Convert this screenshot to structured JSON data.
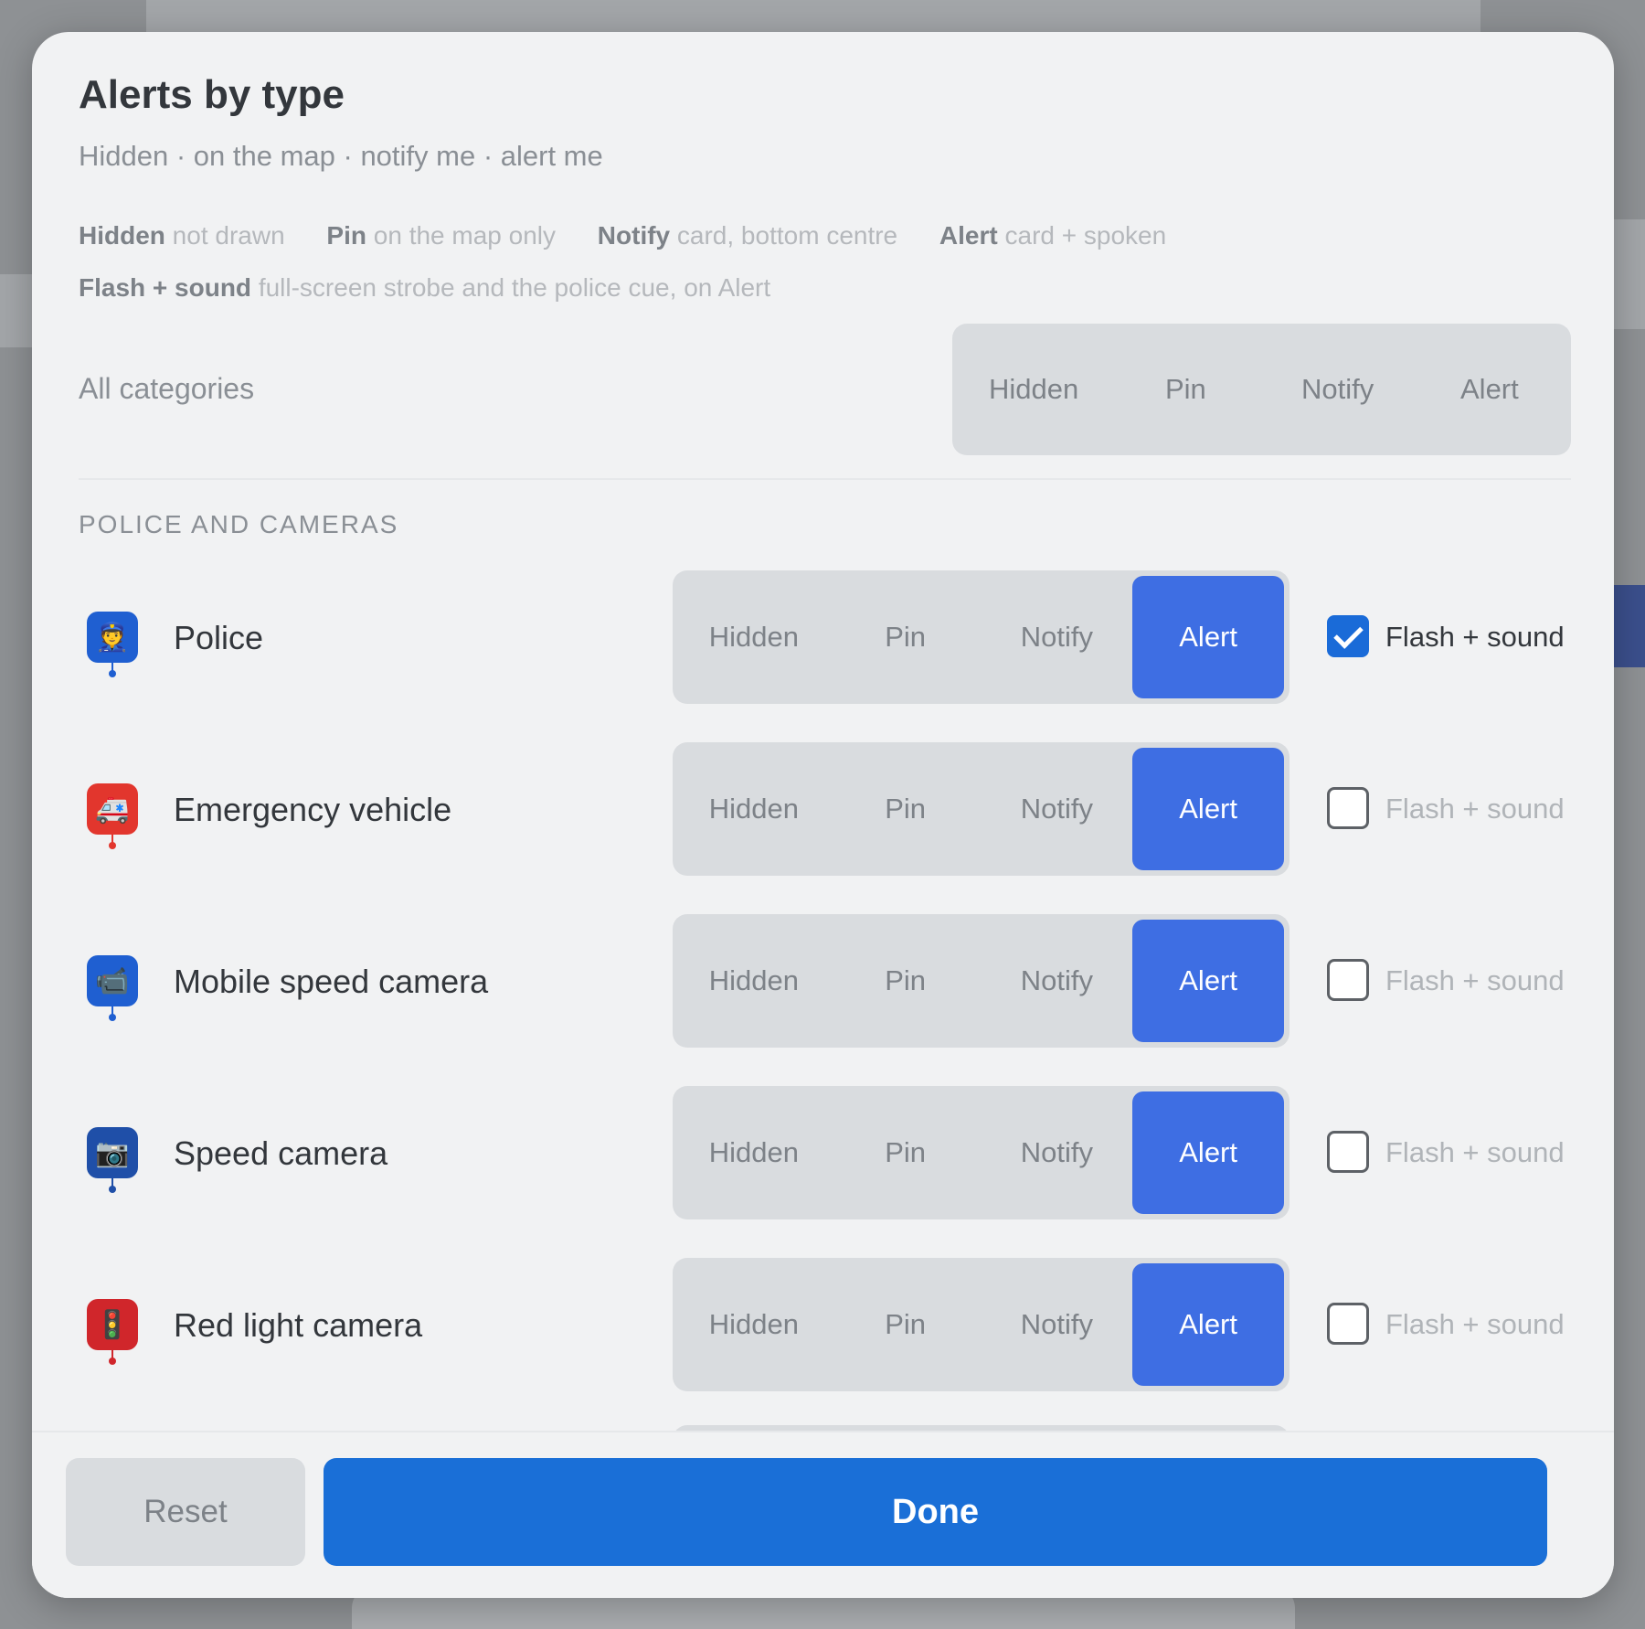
{
  "dialog": {
    "title": "Alerts by type",
    "subtitle": "Hidden · on the map · notify me · alert me",
    "legend": [
      {
        "term": "Hidden",
        "desc": "not drawn"
      },
      {
        "term": "Pin",
        "desc": "on the map only"
      },
      {
        "term": "Notify",
        "desc": "card, bottom centre"
      },
      {
        "term": "Alert",
        "desc": "card + spoken"
      },
      {
        "term": "Flash + sound",
        "desc": "full-screen strobe and the police cue, on Alert"
      }
    ],
    "all_categories": {
      "label": "All categories",
      "options": [
        "Hidden",
        "Pin",
        "Notify",
        "Alert"
      ],
      "selected": null
    },
    "section": "POLICE AND CAMERAS",
    "rows": [
      {
        "label": "Police",
        "icon": "police-officer-icon",
        "icon_color": "#1f5fd1",
        "selected": "Alert",
        "flash_label": "Flash + sound",
        "flash_checked": true
      },
      {
        "label": "Emergency vehicle",
        "icon": "ambulance-icon",
        "icon_color": "#e2362d",
        "selected": "Alert",
        "flash_label": "Flash + sound",
        "flash_checked": false
      },
      {
        "label": "Mobile speed camera",
        "icon": "tripod-camera-icon",
        "icon_color": "#1f5fd1",
        "selected": "Alert",
        "flash_label": "Flash + sound",
        "flash_checked": false
      },
      {
        "label": "Speed camera",
        "icon": "speed-camera-icon",
        "icon_color": "#1f4fa8",
        "selected": "Alert",
        "flash_label": "Flash + sound",
        "flash_checked": false
      },
      {
        "label": "Red light camera",
        "icon": "red-light-camera-icon",
        "icon_color": "#d0262b",
        "selected": "Alert",
        "flash_label": "Flash + sound",
        "flash_checked": false
      }
    ],
    "options": [
      "Hidden",
      "Pin",
      "Notify",
      "Alert"
    ],
    "footer": {
      "reset_label": "Reset",
      "done_label": "Done"
    }
  },
  "colors": {
    "accent": "#3e6ee3",
    "primary_button": "#1a6fd7",
    "checkbox_on": "#1a6bd8"
  }
}
